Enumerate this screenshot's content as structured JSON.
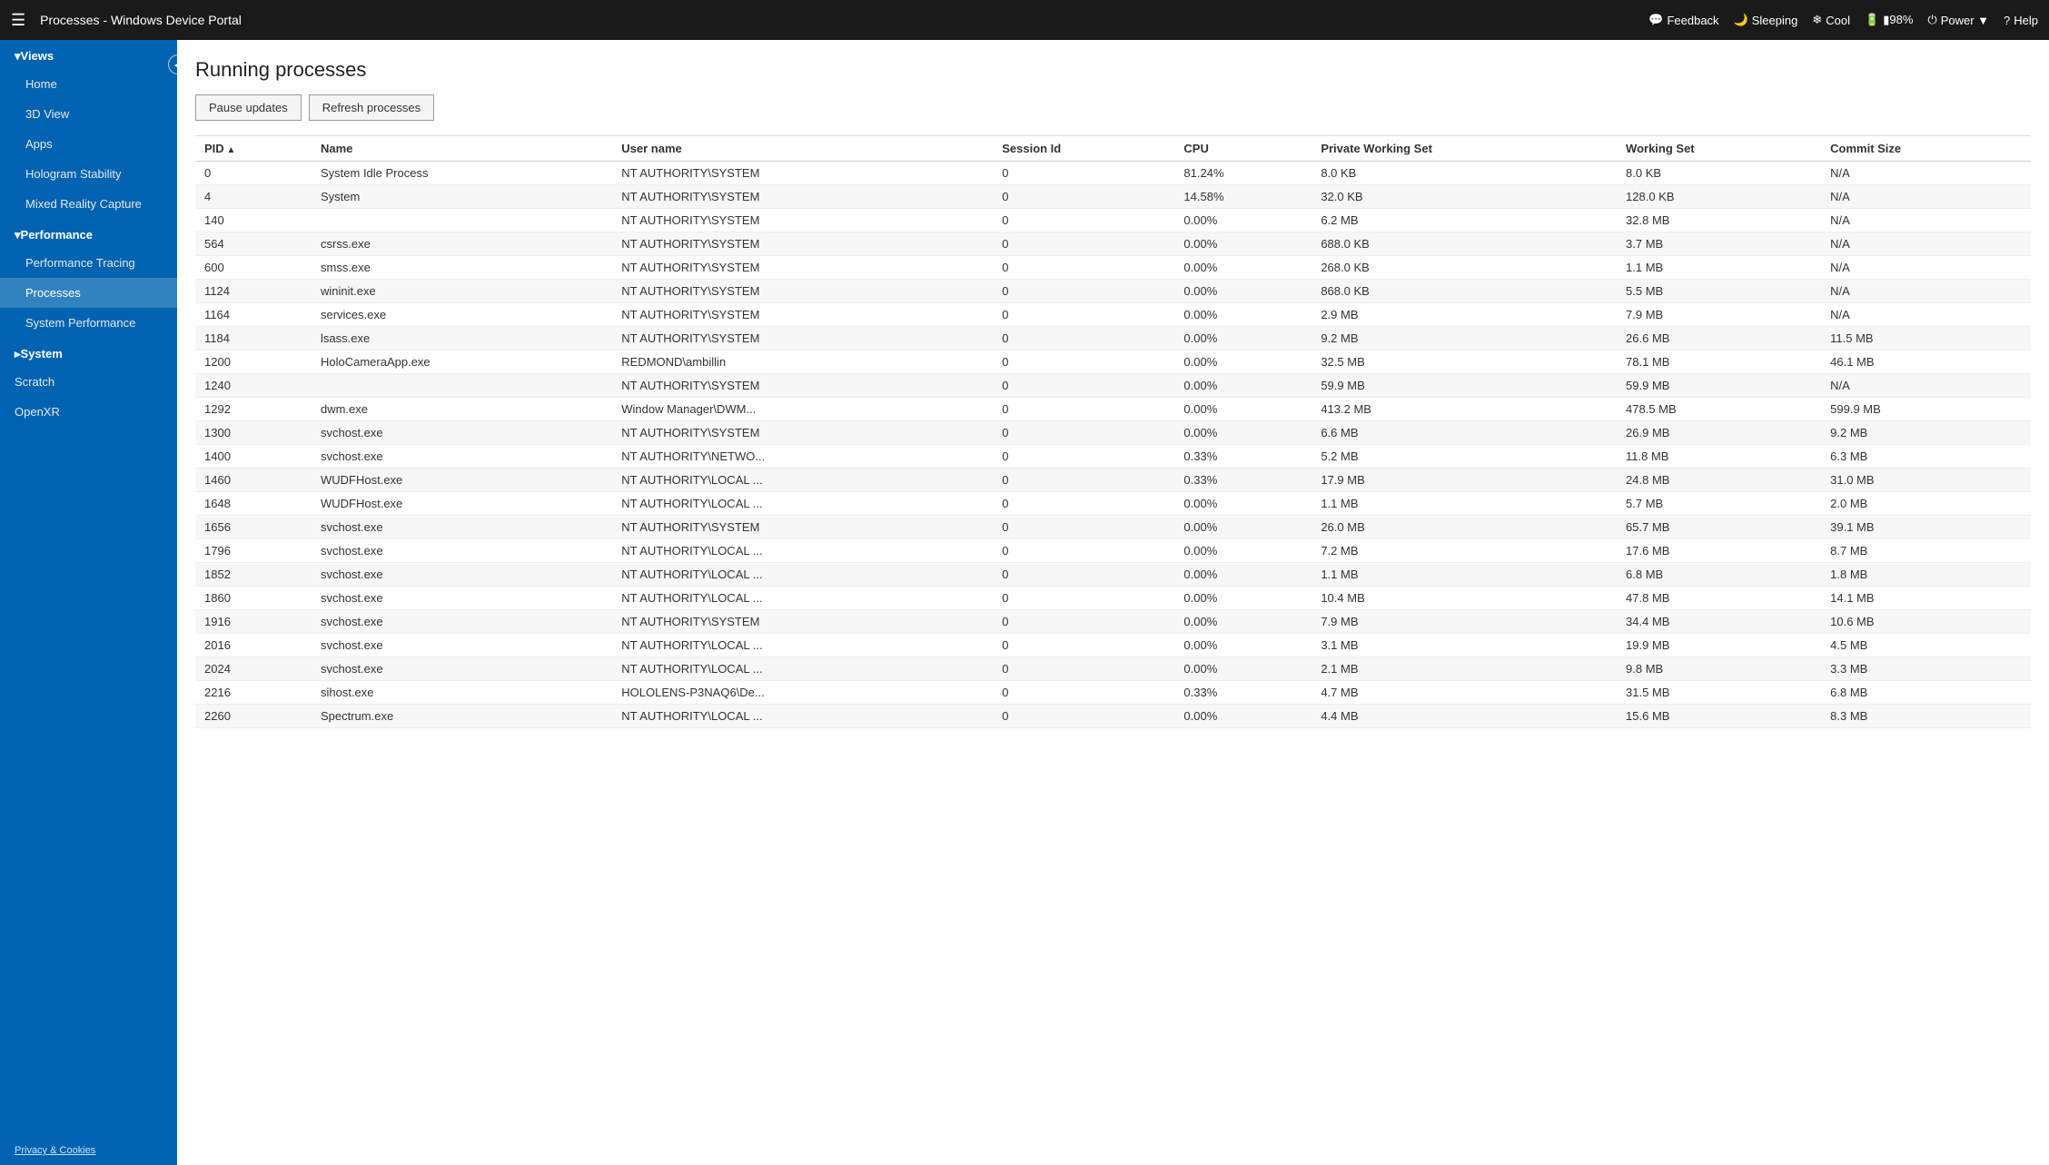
{
  "topbar": {
    "hamburger": "☰",
    "title": "Processes - Windows Device Portal",
    "actions": [
      {
        "id": "feedback",
        "icon": "💬",
        "label": "Feedback"
      },
      {
        "id": "sleeping",
        "icon": "🌙",
        "label": "Sleeping"
      },
      {
        "id": "cool",
        "icon": "❄",
        "label": "Cool"
      },
      {
        "id": "battery",
        "icon": "🔋",
        "label": "▮98%"
      },
      {
        "id": "power",
        "icon": "⏻",
        "label": "Power ▼"
      },
      {
        "id": "help",
        "icon": "?",
        "label": "Help"
      }
    ]
  },
  "sidebar": {
    "collapse_icon": "◀",
    "sections": [
      {
        "id": "views",
        "label": "▾Views",
        "items": [
          {
            "id": "home",
            "label": "Home",
            "active": false
          },
          {
            "id": "3dview",
            "label": "3D View",
            "active": false
          },
          {
            "id": "apps",
            "label": "Apps",
            "active": false
          },
          {
            "id": "hologram-stability",
            "label": "Hologram Stability",
            "active": false
          },
          {
            "id": "mixed-reality-capture",
            "label": "Mixed Reality Capture",
            "active": false
          }
        ]
      },
      {
        "id": "performance",
        "label": "▾Performance",
        "items": [
          {
            "id": "performance-tracing",
            "label": "Performance Tracing",
            "active": false
          },
          {
            "id": "processes",
            "label": "Processes",
            "active": true
          },
          {
            "id": "system-performance",
            "label": "System Performance",
            "active": false
          }
        ]
      },
      {
        "id": "system",
        "label": "▸System",
        "items": []
      },
      {
        "id": "scratch",
        "label": "Scratch",
        "items": []
      },
      {
        "id": "openxr",
        "label": "OpenXR",
        "items": []
      }
    ],
    "footer": "Privacy & Cookies"
  },
  "page": {
    "title": "Running processes",
    "buttons": {
      "pause": "Pause updates",
      "refresh": "Refresh processes"
    }
  },
  "table": {
    "columns": [
      {
        "id": "pid",
        "label": "PID",
        "sort": "asc"
      },
      {
        "id": "name",
        "label": "Name"
      },
      {
        "id": "username",
        "label": "User name"
      },
      {
        "id": "session",
        "label": "Session Id"
      },
      {
        "id": "cpu",
        "label": "CPU"
      },
      {
        "id": "private",
        "label": "Private Working Set"
      },
      {
        "id": "working",
        "label": "Working Set"
      },
      {
        "id": "commit",
        "label": "Commit Size"
      }
    ],
    "rows": [
      {
        "pid": "0",
        "name": "System Idle Process",
        "username": "NT AUTHORITY\\SYSTEM",
        "session": "0",
        "cpu": "81.24%",
        "private": "8.0 KB",
        "working": "8.0 KB",
        "commit": "N/A"
      },
      {
        "pid": "4",
        "name": "System",
        "username": "NT AUTHORITY\\SYSTEM",
        "session": "0",
        "cpu": "14.58%",
        "private": "32.0 KB",
        "working": "128.0 KB",
        "commit": "N/A"
      },
      {
        "pid": "140",
        "name": "",
        "username": "NT AUTHORITY\\SYSTEM",
        "session": "0",
        "cpu": "0.00%",
        "private": "6.2 MB",
        "working": "32.8 MB",
        "commit": "N/A"
      },
      {
        "pid": "564",
        "name": "csrss.exe",
        "username": "NT AUTHORITY\\SYSTEM",
        "session": "0",
        "cpu": "0.00%",
        "private": "688.0 KB",
        "working": "3.7 MB",
        "commit": "N/A"
      },
      {
        "pid": "600",
        "name": "smss.exe",
        "username": "NT AUTHORITY\\SYSTEM",
        "session": "0",
        "cpu": "0.00%",
        "private": "268.0 KB",
        "working": "1.1 MB",
        "commit": "N/A"
      },
      {
        "pid": "1124",
        "name": "wininit.exe",
        "username": "NT AUTHORITY\\SYSTEM",
        "session": "0",
        "cpu": "0.00%",
        "private": "868.0 KB",
        "working": "5.5 MB",
        "commit": "N/A"
      },
      {
        "pid": "1164",
        "name": "services.exe",
        "username": "NT AUTHORITY\\SYSTEM",
        "session": "0",
        "cpu": "0.00%",
        "private": "2.9 MB",
        "working": "7.9 MB",
        "commit": "N/A"
      },
      {
        "pid": "1184",
        "name": "lsass.exe",
        "username": "NT AUTHORITY\\SYSTEM",
        "session": "0",
        "cpu": "0.00%",
        "private": "9.2 MB",
        "working": "26.6 MB",
        "commit": "11.5 MB"
      },
      {
        "pid": "1200",
        "name": "HoloCameraApp.exe",
        "username": "REDMOND\\ambillin",
        "session": "0",
        "cpu": "0.00%",
        "private": "32.5 MB",
        "working": "78.1 MB",
        "commit": "46.1 MB"
      },
      {
        "pid": "1240",
        "name": "",
        "username": "NT AUTHORITY\\SYSTEM",
        "session": "0",
        "cpu": "0.00%",
        "private": "59.9 MB",
        "working": "59.9 MB",
        "commit": "N/A"
      },
      {
        "pid": "1292",
        "name": "dwm.exe",
        "username": "Window Manager\\DWM...",
        "session": "0",
        "cpu": "0.00%",
        "private": "413.2 MB",
        "working": "478.5 MB",
        "commit": "599.9 MB"
      },
      {
        "pid": "1300",
        "name": "svchost.exe",
        "username": "NT AUTHORITY\\SYSTEM",
        "session": "0",
        "cpu": "0.00%",
        "private": "6.6 MB",
        "working": "26.9 MB",
        "commit": "9.2 MB"
      },
      {
        "pid": "1400",
        "name": "svchost.exe",
        "username": "NT AUTHORITY\\NETWO...",
        "session": "0",
        "cpu": "0.33%",
        "private": "5.2 MB",
        "working": "11.8 MB",
        "commit": "6.3 MB"
      },
      {
        "pid": "1460",
        "name": "WUDFHost.exe",
        "username": "NT AUTHORITY\\LOCAL ...",
        "session": "0",
        "cpu": "0.33%",
        "private": "17.9 MB",
        "working": "24.8 MB",
        "commit": "31.0 MB"
      },
      {
        "pid": "1648",
        "name": "WUDFHost.exe",
        "username": "NT AUTHORITY\\LOCAL ...",
        "session": "0",
        "cpu": "0.00%",
        "private": "1.1 MB",
        "working": "5.7 MB",
        "commit": "2.0 MB"
      },
      {
        "pid": "1656",
        "name": "svchost.exe",
        "username": "NT AUTHORITY\\SYSTEM",
        "session": "0",
        "cpu": "0.00%",
        "private": "26.0 MB",
        "working": "65.7 MB",
        "commit": "39.1 MB"
      },
      {
        "pid": "1796",
        "name": "svchost.exe",
        "username": "NT AUTHORITY\\LOCAL ...",
        "session": "0",
        "cpu": "0.00%",
        "private": "7.2 MB",
        "working": "17.6 MB",
        "commit": "8.7 MB"
      },
      {
        "pid": "1852",
        "name": "svchost.exe",
        "username": "NT AUTHORITY\\LOCAL ...",
        "session": "0",
        "cpu": "0.00%",
        "private": "1.1 MB",
        "working": "6.8 MB",
        "commit": "1.8 MB"
      },
      {
        "pid": "1860",
        "name": "svchost.exe",
        "username": "NT AUTHORITY\\LOCAL ...",
        "session": "0",
        "cpu": "0.00%",
        "private": "10.4 MB",
        "working": "47.8 MB",
        "commit": "14.1 MB"
      },
      {
        "pid": "1916",
        "name": "svchost.exe",
        "username": "NT AUTHORITY\\SYSTEM",
        "session": "0",
        "cpu": "0.00%",
        "private": "7.9 MB",
        "working": "34.4 MB",
        "commit": "10.6 MB"
      },
      {
        "pid": "2016",
        "name": "svchost.exe",
        "username": "NT AUTHORITY\\LOCAL ...",
        "session": "0",
        "cpu": "0.00%",
        "private": "3.1 MB",
        "working": "19.9 MB",
        "commit": "4.5 MB"
      },
      {
        "pid": "2024",
        "name": "svchost.exe",
        "username": "NT AUTHORITY\\LOCAL ...",
        "session": "0",
        "cpu": "0.00%",
        "private": "2.1 MB",
        "working": "9.8 MB",
        "commit": "3.3 MB"
      },
      {
        "pid": "2216",
        "name": "sihost.exe",
        "username": "HOLOLENS-P3NAQ6\\De...",
        "session": "0",
        "cpu": "0.33%",
        "private": "4.7 MB",
        "working": "31.5 MB",
        "commit": "6.8 MB"
      },
      {
        "pid": "2260",
        "name": "Spectrum.exe",
        "username": "NT AUTHORITY\\LOCAL ...",
        "session": "0",
        "cpu": "0.00%",
        "private": "4.4 MB",
        "working": "15.6 MB",
        "commit": "8.3 MB"
      }
    ]
  }
}
